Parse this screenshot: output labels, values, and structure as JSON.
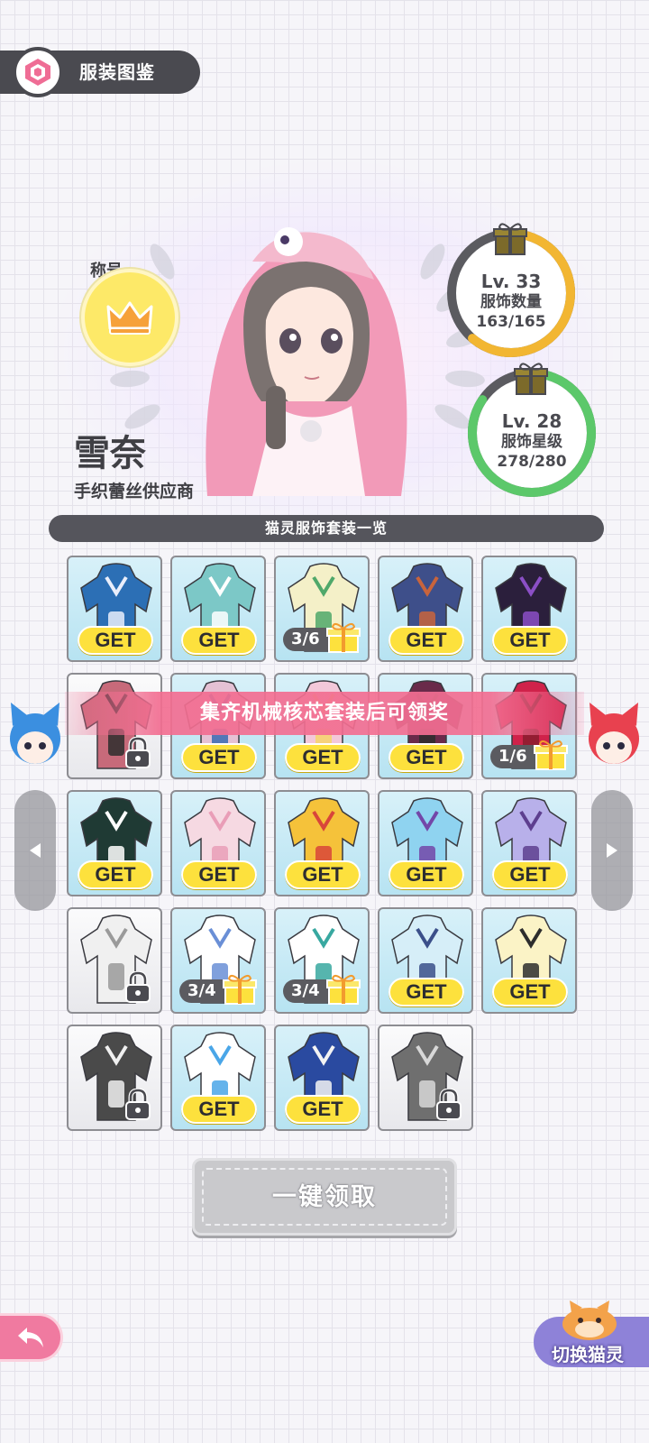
{
  "header": {
    "title": "服装图鉴"
  },
  "character": {
    "title_label": "称号",
    "name": "雪奈",
    "subtitle": "手织蕾丝供应商"
  },
  "stats": {
    "outfit_count": {
      "level": "Lv. 33",
      "label": "服饰数量",
      "value": "163/165",
      "progress": 0.988,
      "color": "#f2b632"
    },
    "outfit_stars": {
      "level": "Lv. 28",
      "label": "服饰星级",
      "value": "278/280",
      "progress": 0.993,
      "color": "#5cc86a"
    }
  },
  "section_title": "猫灵服饰套装一览",
  "toast": "集齐机械核芯套装后可领奖",
  "buttons": {
    "get_label": "GET",
    "claim_all": "一键领取",
    "switch_cat": "切换猫灵"
  },
  "outfits": [
    {
      "state": "get",
      "main": "#2c6fb5",
      "accent": "#e9eefb"
    },
    {
      "state": "get",
      "main": "#7cc8c7",
      "accent": "#ffffff"
    },
    {
      "state": "progress",
      "progress": "3/6",
      "main": "#f4f0c8",
      "accent": "#4fa86a"
    },
    {
      "state": "get",
      "main": "#3e4f8a",
      "accent": "#c8643c"
    },
    {
      "state": "get",
      "main": "#2b1f3c",
      "accent": "#8b4fc6"
    },
    {
      "state": "locked",
      "main": "#c76a7a",
      "accent": "#2d2d2d"
    },
    {
      "state": "get",
      "main": "#e5c1d4",
      "accent": "#3a6ab2"
    },
    {
      "state": "get",
      "main": "#f3c8d9",
      "accent": "#f6d36a"
    },
    {
      "state": "get",
      "main": "#6a2a4a",
      "accent": "#2d2d2d"
    },
    {
      "state": "progress",
      "progress": "1/6",
      "main": "#d0224a",
      "accent": "#8a1c2e"
    },
    {
      "state": "get",
      "main": "#1f3a34",
      "accent": "#ffffff"
    },
    {
      "state": "get",
      "main": "#f6d9e2",
      "accent": "#e99db7"
    },
    {
      "state": "get",
      "main": "#f5c23a",
      "accent": "#d8453a"
    },
    {
      "state": "get",
      "main": "#8fd3f0",
      "accent": "#7346a8"
    },
    {
      "state": "get",
      "main": "#b8b0ea",
      "accent": "#5d3f8f"
    },
    {
      "state": "locked",
      "main": "#f0f0f0",
      "accent": "#9a9a9a"
    },
    {
      "state": "progress",
      "progress": "3/4",
      "main": "#ffffff",
      "accent": "#6a8fd6"
    },
    {
      "state": "progress",
      "progress": "3/4",
      "main": "#ffffff",
      "accent": "#38a8a0"
    },
    {
      "state": "get",
      "main": "#d6eef8",
      "accent": "#3b4f8a"
    },
    {
      "state": "get",
      "main": "#fbf3c6",
      "accent": "#2d2d2d"
    },
    {
      "state": "locked",
      "main": "#4a4a4a",
      "accent": "#f0f0f0"
    },
    {
      "state": "get",
      "main": "#ffffff",
      "accent": "#4aa6e8"
    },
    {
      "state": "get",
      "main": "#2a4aa0",
      "accent": "#f3f3f3"
    },
    {
      "state": "locked",
      "main": "#6f6f6f",
      "accent": "#d8d8d8"
    }
  ]
}
